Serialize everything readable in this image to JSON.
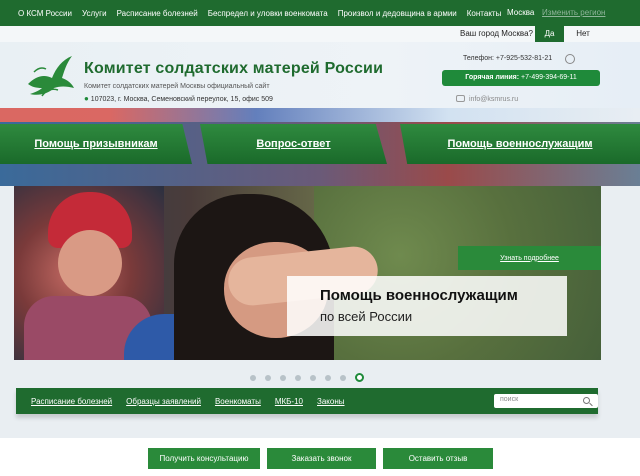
{
  "topnav": {
    "links": [
      "О КСМ России",
      "Услуги",
      "Расписание болезней",
      "Беспредел и уловки военкомата",
      "Произвол и дедовщина в армии",
      "Контакты"
    ],
    "city": "Москва",
    "change_city": "Изменить регион"
  },
  "city_question": {
    "question": "Ваш город Москва?",
    "yes": "Да",
    "no": "Нет"
  },
  "header": {
    "title": "Комитет солдатских матерей России",
    "subtitle": "Комитет солдатских матерей Москвы официальный сайт",
    "address": "107023, г. Москва, Семеновский переулок, 15, офис 509",
    "phone": "Телефон: +7-925-532-81-21",
    "hotline_label": "Горячая линия:",
    "hotline_number": "+7-499-394-69-11",
    "email": "info@ksmrus.ru",
    "logo_icon": "dove-logo-icon"
  },
  "main_nav": [
    "Помощь призывникам",
    "Вопрос-ответ",
    "Помощь военнослужащим"
  ],
  "banner": {
    "more_button": "Узнать подробнее",
    "caption_line1": "Помощь военнослужащим",
    "caption_line2": "по всей России",
    "slides_total": 8,
    "active_slide": 8
  },
  "subnav": {
    "links": [
      "Расписание болезней",
      "Образцы заявлений",
      "Военкоматы",
      "МКБ-10",
      "Законы"
    ],
    "search_placeholder": "поиск"
  },
  "cta": [
    "Получить консультацию",
    "Заказать звонок",
    "Оставить отзыв"
  ],
  "colors": {
    "primary_green": "#1f6b2f",
    "accent_green": "#2a8a3a"
  }
}
